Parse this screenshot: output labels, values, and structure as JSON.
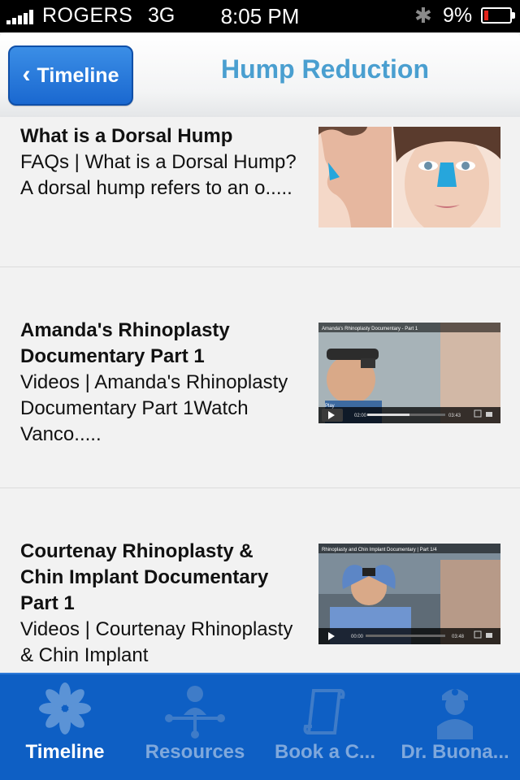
{
  "status_bar": {
    "carrier": "ROGERS",
    "network": "3G",
    "time": "8:05 PM",
    "battery": "9%"
  },
  "nav": {
    "back_label": "Timeline",
    "title": "Hump Reduction"
  },
  "items": [
    {
      "title": "What is a Dorsal Hump",
      "description": "FAQs | What is a Dorsal Hump?A dorsal hump refers to an o.....",
      "thumbnail": "nose-illustration-image"
    },
    {
      "title": "Amanda's Rhinoplasty Documentary Part 1",
      "description": "Videos | Amanda's Rhinoplasty Documentary Part 1Watch Vanco.....",
      "thumbnail": "video-thumbnail",
      "video_caption": "Amanda's Rhinoplasty Documentary - Part 1",
      "play_label": "Play",
      "time_elapsed": "02:00",
      "time_total": "03:43"
    },
    {
      "title": "Courtenay Rhinoplasty & Chin Implant Documentary Part 1",
      "description": "Videos | Courtenay Rhinoplasty & Chin Implant",
      "thumbnail": "video-thumbnail",
      "video_caption": "Rhinoplasty and Chin Implant Documentary | Part 1/4",
      "time_elapsed": "00:00",
      "time_total": "03:48"
    }
  ],
  "tabs": [
    {
      "label": "Timeline",
      "icon": "flower-icon",
      "active": true
    },
    {
      "label": "Resources",
      "icon": "network-icon",
      "active": false
    },
    {
      "label": "Book a C...",
      "icon": "scroll-icon",
      "active": false
    },
    {
      "label": "Dr. Buona...",
      "icon": "doctor-icon",
      "active": false
    }
  ],
  "colors": {
    "accent": "#1a68d0",
    "title": "#4a9fd0",
    "tab_bar": "#0e5fc4"
  }
}
